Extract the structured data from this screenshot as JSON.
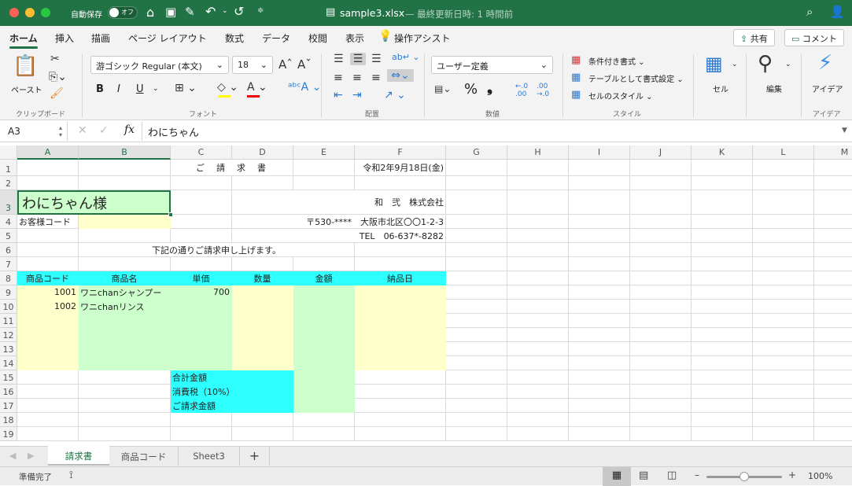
{
  "titlebar": {
    "autosave_label": "自動保存",
    "autosave_state": "オフ",
    "filename": "sample3.xlsx",
    "last_saved": "— 最終更新日時: 1 時間前",
    "accent": "#217346"
  },
  "ribbon_tabs": [
    "ホーム",
    "挿入",
    "描画",
    "ページ レイアウト",
    "数式",
    "データ",
    "校閲",
    "表示",
    "操作アシスト"
  ],
  "share_label": "共有",
  "comment_label": "コメント",
  "clipboard": {
    "paste": "ペースト",
    "group": "クリップボード"
  },
  "font": {
    "name": "游ゴシック Regular (本文)",
    "size": "18",
    "bold": "B",
    "italic": "I",
    "underline": "U",
    "group": "フォント"
  },
  "alignment": {
    "group": "配置"
  },
  "number": {
    "format": "ユーザー定義",
    "group": "数値",
    "percent": "%",
    "comma": "❟"
  },
  "styles": {
    "conditional": "条件付き書式",
    "table": "テーブルとして書式設定",
    "cell_styles": "セルのスタイル",
    "group": "スタイル"
  },
  "cells_label": "セル",
  "edit_label": "編集",
  "ideas_label": "アイデア",
  "ideas_group": "アイデア",
  "formula_bar": {
    "name_box": "A3",
    "fx": "fx",
    "content": "わにちゃん"
  },
  "sheet": {
    "columns": [
      "A",
      "B",
      "C",
      "D",
      "E",
      "F",
      "G",
      "H",
      "I",
      "J",
      "K",
      "L",
      "M"
    ],
    "rows": [
      "1",
      "2",
      "3",
      "4",
      "5",
      "6",
      "7",
      "8",
      "9",
      "10",
      "11",
      "12",
      "13",
      "14",
      "15",
      "16",
      "17",
      "18",
      "19"
    ],
    "cells": {
      "C1": "ご　請　求　書",
      "F1": "令和2年9月18日(金)",
      "A3": "わにちゃん様",
      "D3": "和　弐　株式会社",
      "A4": "お客様コード",
      "D4": "〒530-****　大阪市北区〇〇1-2-3",
      "D5": "TEL　06-637*-8282",
      "B6": "下記の通りご請求申し上げます。",
      "A8": "商品コード",
      "B8": "商品名",
      "C8": "単価",
      "D8": "数量",
      "E8": "金額",
      "F8": "納品日",
      "A9": "1001",
      "B9": "ワニchanシャンプー",
      "C9": "700",
      "A10": "1002",
      "B10": "ワニchanリンス",
      "C15": "合計金額",
      "C16": "消費税（10%）",
      "C17": "ご請求金額"
    },
    "fills": {
      "cyan": "#2effff",
      "green": "#ccffcc",
      "yellow": "#ffffcc"
    }
  },
  "sheet_tabs": [
    "請求書",
    "商品コード",
    "Sheet3"
  ],
  "active_sheet": "請求書",
  "status": {
    "ready": "準備完了",
    "zoom": "100%",
    "zoom_percent": 100
  }
}
